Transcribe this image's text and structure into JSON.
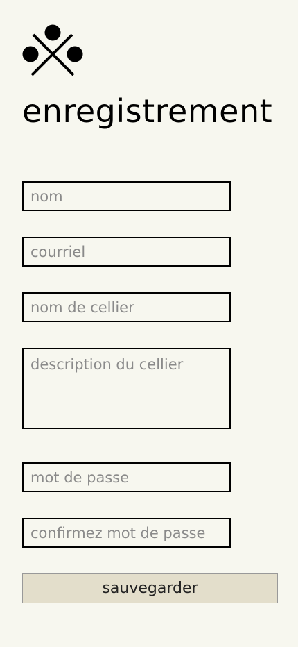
{
  "header": {
    "logo_icon": "crossed-circles-logo-icon",
    "title": "enregistrement"
  },
  "form": {
    "name_placeholder": "nom",
    "email_placeholder": "courriel",
    "cellar_name_placeholder": "nom de cellier",
    "cellar_description_placeholder": "description du cellier",
    "password_placeholder": "mot de passe",
    "confirm_password_placeholder": "confirmez mot de passe",
    "save_label": "sauvegarder"
  },
  "colors": {
    "background": "#f7f7ef",
    "button_background": "#e3decb",
    "placeholder": "#8a8a8a"
  }
}
